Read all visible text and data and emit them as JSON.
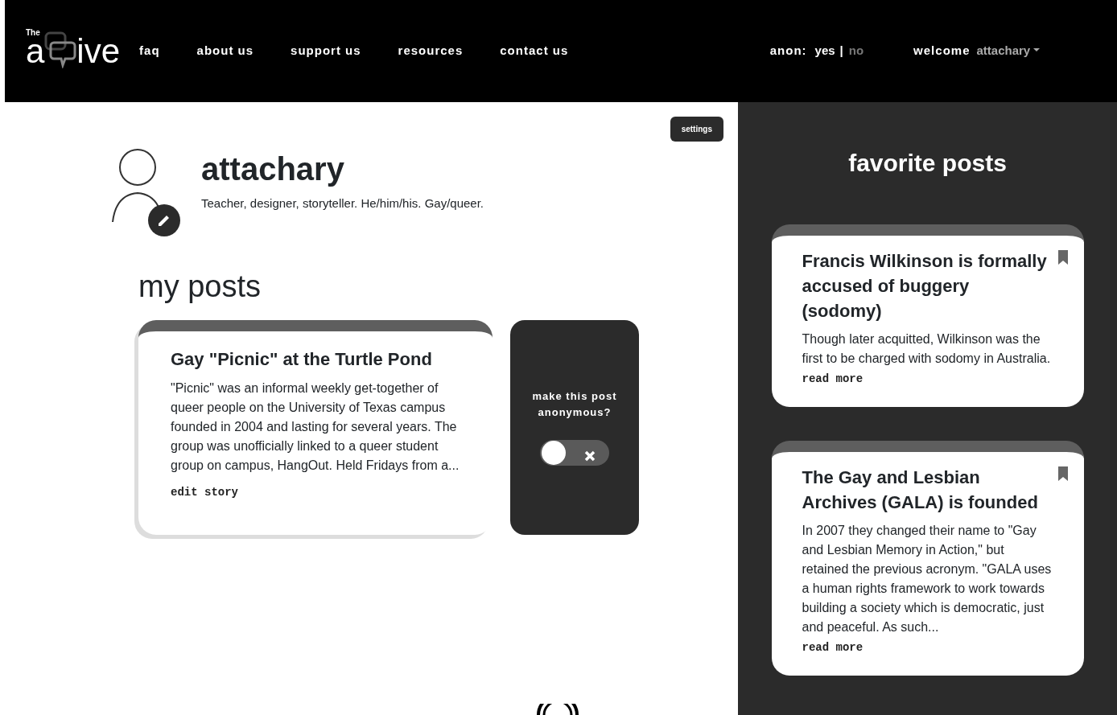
{
  "logo": {
    "small": "The",
    "left": "a",
    "right": "ive"
  },
  "nav": {
    "links": [
      "faq",
      "about us",
      "support us",
      "resources",
      "contact us"
    ],
    "anon": {
      "label": "anon:",
      "options": [
        {
          "label": "yes",
          "selected": true
        },
        {
          "label": "no",
          "selected": false
        }
      ],
      "separator": "|"
    },
    "welcome": {
      "label": "welcome",
      "user": "attachary"
    }
  },
  "profile": {
    "settings": "settings",
    "name": "attachary",
    "bio": "Teacher, designer, storyteller. He/him/his. Gay/queer."
  },
  "my_posts": {
    "heading": "my posts",
    "posts": [
      {
        "title": "Gay \"Picnic\" at the Turtle Pond",
        "body": "\"Picnic\" was an informal weekly get-together of queer people on the University of Texas campus founded in 2004 and lasting for several years. The group was unofficially linked to a queer student group on campus, HangOut. Held Fridays from a...",
        "link": "edit story",
        "anon_prompt": "make this post anonymous?",
        "anonymous": false
      }
    ]
  },
  "favorites": {
    "heading": "favorite posts",
    "posts": [
      {
        "title": "Francis Wilkinson is formally accused of buggery (sodomy)",
        "body": "Though later acquitted, Wilkinson was the first to be charged with sodomy in Australia.",
        "link": "read more",
        "bookmarked": true
      },
      {
        "title": "The Gay and Lesbian Archives (GALA) is founded",
        "body": "In 2007 they changed their name to \"Gay and Lesbian Memory in Action,\" but retained the previous acronym. \"GALA uses a human rights framework to work towards building a society which is democratic, just and peaceful. As such...",
        "link": "read more",
        "bookmarked": true
      }
    ]
  }
}
